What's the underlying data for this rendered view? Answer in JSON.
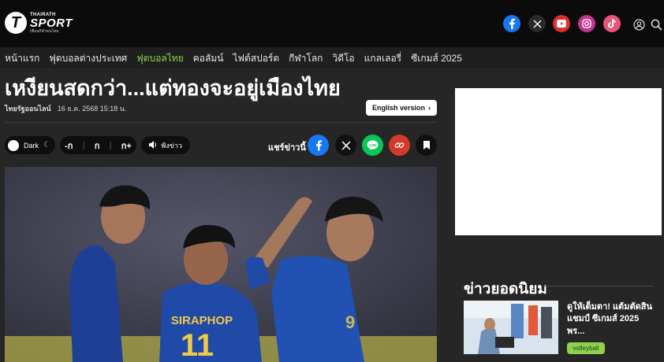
{
  "header": {
    "logo_top": "THAIRATH",
    "logo_main": "SPORT",
    "logo_tagline": "เพื่อนกีฬาคนไทย",
    "social_icons": [
      "facebook-icon",
      "x-icon",
      "youtube-icon",
      "instagram-icon",
      "tiktok-icon"
    ],
    "social_colors": {
      "facebook": "#1877f2",
      "x": "#2a2a2a",
      "youtube": "#e02d2d",
      "instagram": "#c1358f",
      "tiktok": "#e8547a"
    },
    "utility_icons": [
      "user-icon",
      "search-icon"
    ]
  },
  "nav": {
    "items": [
      {
        "label": "หน้าแรก",
        "active": false
      },
      {
        "label": "ฟุตบอลต่างประเทศ",
        "active": false
      },
      {
        "label": "ฟุตบอลไทย",
        "active": true
      },
      {
        "label": "คอลัมน์",
        "active": false
      },
      {
        "label": "ไฟต์สปอร์ต",
        "active": false
      },
      {
        "label": "กีฬาโลก",
        "active": false
      },
      {
        "label": "วิดีโอ",
        "active": false
      },
      {
        "label": "แกลเลอรี่",
        "active": false
      },
      {
        "label": "ซีเกมส์ 2025",
        "active": false
      }
    ],
    "accent_color": "#8fd14f"
  },
  "article": {
    "headline": "เหงียนสดกว่า...แต่ทองจะอยู่เมืองไทย",
    "source": "ไทยรัฐออนไลน์",
    "date": "16 ธ.ค. 2568 15:18 น.",
    "english_button": "English version",
    "dark_toggle_label": "Dark",
    "font_controls": [
      "-ก",
      "ก",
      "ก+"
    ],
    "listen_label": "ฟังข่าว",
    "share_label": "แชร์ข่าวนี้",
    "share_icons": [
      "facebook-icon",
      "x-icon",
      "line-icon",
      "link-icon",
      "bookmark-icon"
    ],
    "player_shirt_text": "SIRAPHOP",
    "player_shirt_number": "11"
  },
  "sidebar": {
    "popular_title": "ข่าวยอดนิยม",
    "popular_items": [
      {
        "headline": "ดูให้เต็มตา! แต้มตัดสินแชมป์ ซีเกมส์ 2025 พร...",
        "tag": "volleyball"
      }
    ]
  }
}
